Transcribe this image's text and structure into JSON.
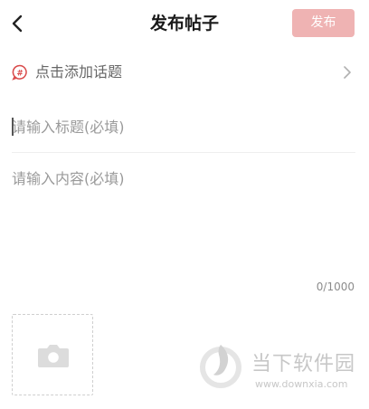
{
  "header": {
    "title": "发布帖子",
    "publish_label": "发布",
    "back_icon": "chevron-left-icon"
  },
  "topic": {
    "label": "点击添加话题",
    "icon": "hashtag-bubble-icon",
    "arrow_icon": "chevron-right-icon"
  },
  "title_field": {
    "placeholder": "请输入标题(必填)",
    "value": ""
  },
  "content_field": {
    "placeholder": "请输入内容(必填)",
    "value": ""
  },
  "counter": "0/1000",
  "image_picker": {
    "icon": "camera-icon"
  },
  "watermark": {
    "name": "当下软件园",
    "url": "www.downxia.com"
  },
  "colors": {
    "accent": "#efb3b3",
    "topic_icon": "#d94a4a",
    "placeholder": "#9a9a9a"
  }
}
